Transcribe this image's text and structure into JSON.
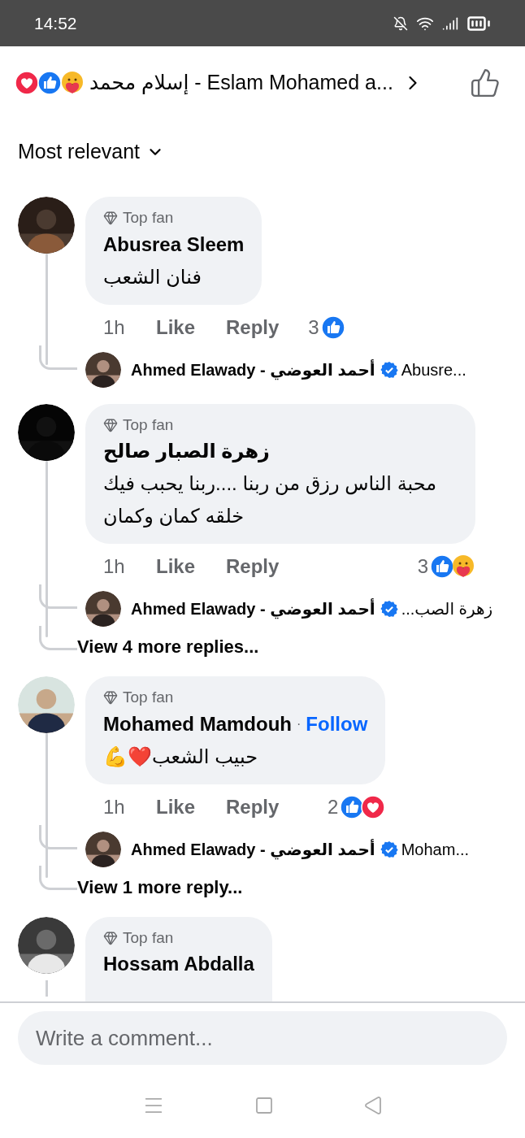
{
  "status_bar": {
    "time": "14:52"
  },
  "header": {
    "reactions": [
      {
        "kind": "love"
      },
      {
        "kind": "like"
      },
      {
        "kind": "care"
      }
    ],
    "title": "إسلام محمد - Eslam Mohamed a..."
  },
  "sort": {
    "label": "Most relevant"
  },
  "comments": [
    {
      "badge": "Top fan",
      "author": "Abusrea Sleem",
      "text": "فنان الشعب",
      "time": "1h",
      "like": "Like",
      "reply": "Reply",
      "reaction_count": "3",
      "reactions": [
        {
          "kind": "like"
        }
      ],
      "replies": [
        {
          "author": "Ahmed Elawady - أحمد العوضي",
          "verified": true,
          "preview": "Abusre..."
        }
      ]
    },
    {
      "badge": "Top fan",
      "author": "زهرة الصبار صالح",
      "text": "محبة الناس رزق من ربنا ....ربنا يحبب فيك خلقه كمان وكمان",
      "time": "1h",
      "like": "Like",
      "reply": "Reply",
      "reaction_count": "3",
      "reactions": [
        {
          "kind": "like"
        },
        {
          "kind": "care"
        }
      ],
      "replies": [
        {
          "author": "Ahmed Elawady - أحمد العوضي",
          "verified": true,
          "preview": "زهرة الصب..."
        }
      ],
      "more_replies": "View 4 more replies..."
    },
    {
      "badge": "Top fan",
      "author": "Mohamed Mamdouh",
      "separator": "·",
      "follow": "Follow",
      "text": "حبيب الشعب❤️💪",
      "time": "1h",
      "like": "Like",
      "reply": "Reply",
      "reaction_count": "2",
      "reactions": [
        {
          "kind": "like"
        },
        {
          "kind": "love"
        }
      ],
      "replies": [
        {
          "author": "Ahmed Elawady - أحمد العوضي",
          "verified": true,
          "preview": "Moham..."
        }
      ],
      "more_replies": "View 1 more reply..."
    },
    {
      "badge": "Top fan",
      "author": "Hossam Abdalla"
    }
  ],
  "composer": {
    "placeholder": "Write a comment..."
  }
}
